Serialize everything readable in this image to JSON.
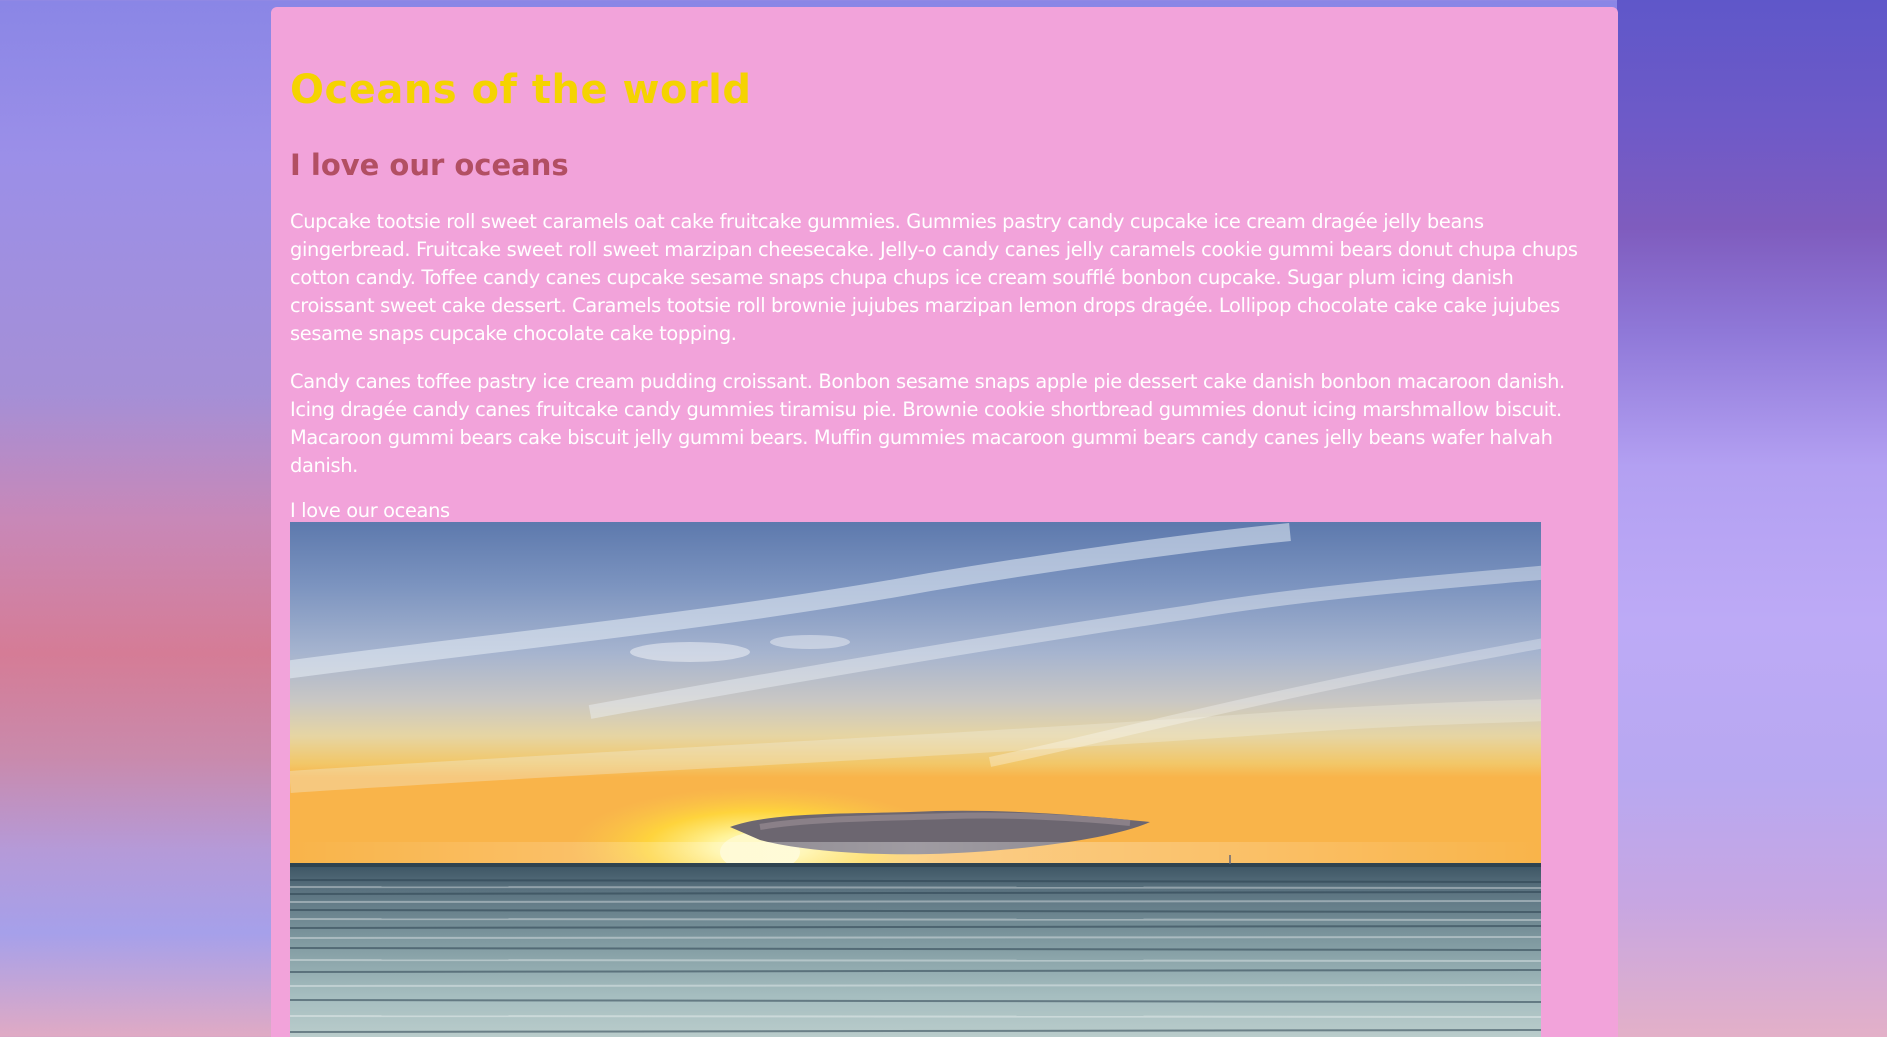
{
  "page": {
    "title": "Oceans of the world",
    "subtitle": "I love our oceans",
    "paragraphs": [
      "Cupcake tootsie roll sweet caramels oat cake fruitcake gummies. Gummies pastry candy cupcake ice cream dragée jelly beans gingerbread. Fruitcake sweet roll sweet marzipan cheesecake. Jelly-o candy canes jelly caramels cookie gummi bears donut chupa chups cotton candy. Toffee candy canes cupcake sesame snaps chupa chups ice cream soufflé bonbon cupcake. Sugar plum icing danish croissant sweet cake dessert. Caramels tootsie roll brownie jujubes marzipan lemon drops dragée. Lollipop chocolate cake cake jujubes sesame snaps cupcake chocolate cake topping.",
      "Candy canes toffee pastry ice cream pudding croissant. Bonbon sesame snaps apple pie dessert cake danish bonbon macaroon danish. Icing dragée candy canes fruitcake candy gummies tiramisu pie. Brownie cookie shortbread gummies donut icing marshmallow biscuit. Macaroon gummi bears cake biscuit jelly gummi bears. Muffin gummies macaroon gummi bears candy canes jelly beans wafer halvah danish."
    ],
    "image_caption": "I love our oceans"
  },
  "colors": {
    "panel_background": "#f2a3da",
    "title": "#f5d300",
    "subtitle": "#b24f63",
    "body_text": "#ffffff"
  },
  "image": {
    "subject": "ocean-sunset-photo"
  }
}
